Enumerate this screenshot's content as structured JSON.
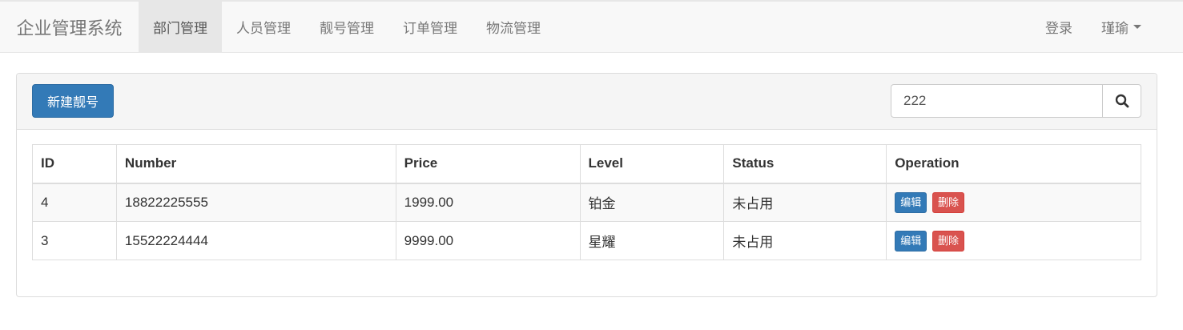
{
  "navbar": {
    "brand": "企业管理系统",
    "links": [
      {
        "label": "部门管理",
        "active": true
      },
      {
        "label": "人员管理",
        "active": false
      },
      {
        "label": "靓号管理",
        "active": false
      },
      {
        "label": "订单管理",
        "active": false
      },
      {
        "label": "物流管理",
        "active": false
      }
    ],
    "login": "登录",
    "user": "瑾瑜"
  },
  "toolbar": {
    "new_button": "新建靓号",
    "search_value": "222",
    "search_icon": "search-icon"
  },
  "table": {
    "headers": [
      "ID",
      "Number",
      "Price",
      "Level",
      "Status",
      "Operation"
    ],
    "rows": [
      {
        "id": "4",
        "number": "18822225555",
        "price": "1999.00",
        "level": "铂金",
        "status": "未占用",
        "edit": "编辑",
        "delete": "删除"
      },
      {
        "id": "3",
        "number": "15522224444",
        "price": "9999.00",
        "level": "星耀",
        "status": "未占用",
        "edit": "编辑",
        "delete": "删除"
      }
    ]
  },
  "colors": {
    "primary": "#337ab7",
    "danger": "#d9534f"
  }
}
